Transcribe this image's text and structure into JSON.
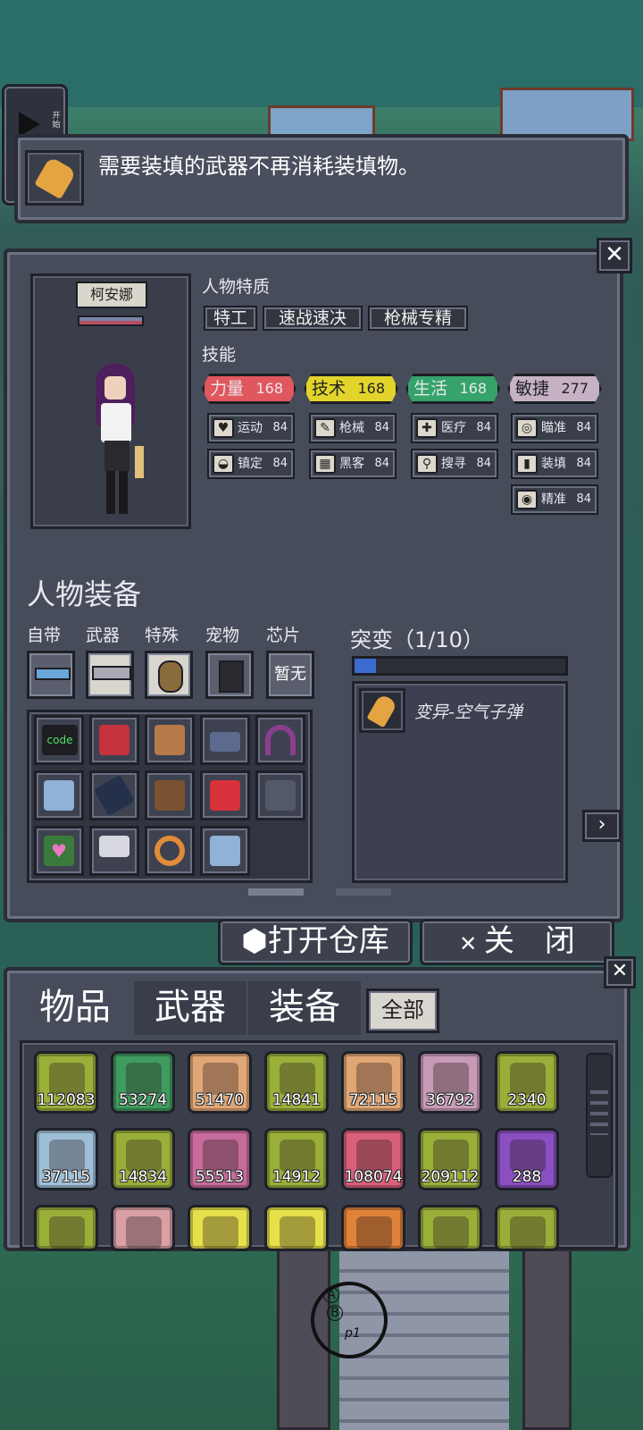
{
  "top_banner": {
    "message": "需要装填的武器不再消耗装填物。",
    "play_label": "开始"
  },
  "character": {
    "name": "柯安娜",
    "traits_title": "人物特质",
    "traits": [
      "特工",
      "速战速决",
      "枪械专精"
    ],
    "skills_title": "技能",
    "stats": [
      {
        "label": "力量",
        "value": "168",
        "color": "#e0585e"
      },
      {
        "label": "技术",
        "value": "168",
        "color": "#e2d42a"
      },
      {
        "label": "生活",
        "value": "168",
        "color": "#35a36a"
      },
      {
        "label": "敏捷",
        "value": "277",
        "color": "#c6b2c4"
      }
    ],
    "skills": [
      {
        "icon": "heart-icon",
        "glyph": "♥",
        "label": "运动",
        "level": "84"
      },
      {
        "icon": "gun-icon",
        "glyph": "✎",
        "label": "枪械",
        "level": "84"
      },
      {
        "icon": "medkit-icon",
        "glyph": "✚",
        "label": "医疗",
        "level": "84"
      },
      {
        "icon": "crosshair-icon",
        "glyph": "◎",
        "label": "瞄准",
        "level": "84"
      },
      {
        "icon": "glasses-icon",
        "glyph": "◒",
        "label": "镇定",
        "level": "84"
      },
      {
        "icon": "hacker-icon",
        "glyph": "▦",
        "label": "黑客",
        "level": "84"
      },
      {
        "icon": "magnifier-icon",
        "glyph": "⚲",
        "label": "搜寻",
        "level": "84"
      },
      {
        "icon": "reload-icon",
        "glyph": "▮",
        "label": "装填",
        "level": "84"
      },
      {
        "icon": "eye-icon",
        "glyph": "◉",
        "label": "精准",
        "level": "84"
      }
    ]
  },
  "equipment": {
    "title": "人物装备",
    "slots": [
      "自带",
      "武器",
      "特殊",
      "宠物",
      "芯片"
    ],
    "chip_empty": "暂无",
    "inventory_icons": [
      "code-book-icon",
      "red-book-icon",
      "brown-book-icon",
      "vr-headset-icon",
      "headphones-icon",
      "glasses-book-icon",
      "phone-icon",
      "backpack-icon",
      "first-aid-kit-icon",
      "laptop-icon",
      "heart-card-icon",
      "sunglasses-icon",
      "gold-ring-icon",
      "blue-book-icon"
    ],
    "code_text": "code"
  },
  "mutation": {
    "title": "突变（1/10）",
    "progress": 0.1,
    "items": [
      {
        "icon": "air-bullet-icon",
        "label": "变异-空气子弹"
      }
    ]
  },
  "buttons": {
    "open_storage": "打开仓库",
    "close": "关　闭"
  },
  "bag": {
    "tabs": [
      "物品",
      "武器",
      "装备"
    ],
    "filter": "全部",
    "items": [
      {
        "icon": "supplies-icon",
        "count": "112083",
        "color": "#9aae3a"
      },
      {
        "icon": "log-icon",
        "count": "53274",
        "color": "#3f9b5e"
      },
      {
        "icon": "rope-icon",
        "count": "51470",
        "color": "#e0a675"
      },
      {
        "icon": "meat-icon",
        "count": "14841",
        "color": "#9aae3a"
      },
      {
        "icon": "bread-icon",
        "count": "72115",
        "color": "#e0a675"
      },
      {
        "icon": "pipe-icon",
        "count": "36792",
        "color": "#c79ab6"
      },
      {
        "icon": "herb-icon",
        "count": "2340",
        "color": "#9aae3a"
      },
      {
        "icon": "circuit-icon",
        "count": "37115",
        "color": "#9fbfd8"
      },
      {
        "icon": "chocolate-icon",
        "count": "14834",
        "color": "#9aae3a"
      },
      {
        "icon": "shirt-icon",
        "count": "55513",
        "color": "#c76b9c"
      },
      {
        "icon": "chair-icon",
        "count": "14912",
        "color": "#9aae3a"
      },
      {
        "icon": "medicine-icon",
        "count": "108074",
        "color": "#d9607a"
      },
      {
        "icon": "tape-icon",
        "count": "209112",
        "color": "#9aae3a"
      },
      {
        "icon": "jar-icon",
        "count": "288",
        "color": "#8a4fc0"
      },
      {
        "icon": "apple-icon",
        "count": "",
        "color": "#9aae3a"
      },
      {
        "icon": "tool-icon",
        "count": "",
        "color": "#d9a0a6"
      },
      {
        "icon": "bottle-icon",
        "count": "",
        "color": "#e6e04a"
      },
      {
        "icon": "wine-icon",
        "count": "",
        "color": "#e6e04a"
      },
      {
        "icon": "wrench-icon",
        "count": "",
        "color": "#e0823a"
      },
      {
        "icon": "cloth-icon",
        "count": "",
        "color": "#9aae3a"
      },
      {
        "icon": "chili-icon",
        "count": "",
        "color": "#9aae3a"
      }
    ]
  },
  "hud": {
    "crosshair_labels": [
      "A",
      "B"
    ],
    "crosshair_tag": "p1"
  }
}
